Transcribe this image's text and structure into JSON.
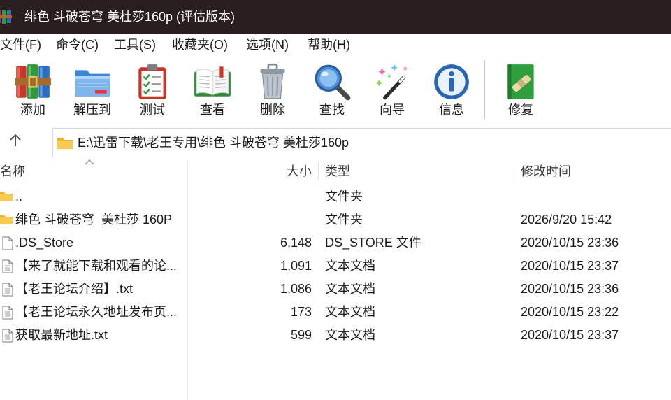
{
  "window": {
    "title": "绯色 斗破苍穹 美杜莎160p (评估版本)",
    "icon": "winrar-app-icon"
  },
  "theme": {
    "titlebar_bg": "#2b1e1e",
    "titlebar_text": "#ffffff",
    "background": "#ffffff"
  },
  "menu": {
    "items": [
      {
        "label": "文件(F)"
      },
      {
        "label": "命令(C)"
      },
      {
        "label": "工具(S)"
      },
      {
        "label": "收藏夹(O)"
      },
      {
        "label": "选项(N)"
      },
      {
        "label": "帮助(H)"
      }
    ]
  },
  "toolbar": {
    "buttons": [
      {
        "label": "添加",
        "icon": "add-archive-icon"
      },
      {
        "label": "解压到",
        "icon": "extract-to-icon"
      },
      {
        "label": "测试",
        "icon": "test-icon"
      },
      {
        "label": "查看",
        "icon": "view-icon"
      },
      {
        "label": "删除",
        "icon": "delete-icon"
      },
      {
        "label": "查找",
        "icon": "find-icon"
      },
      {
        "label": "向导",
        "icon": "wizard-icon"
      },
      {
        "label": "信息",
        "icon": "info-icon"
      },
      {
        "label": "修复",
        "icon": "repair-icon"
      }
    ]
  },
  "address": {
    "up_icon": "up-arrow-icon",
    "folder_icon": "folder-icon",
    "path": "E:\\迅雷下载\\老王专用\\绯色 斗破苍穹 美杜莎160p"
  },
  "columns": {
    "name": "名称",
    "size": "大小",
    "type": "类型",
    "modified": "修改时间",
    "sort_icon": "sort-ascending-icon"
  },
  "files": [
    {
      "icon": "folder-icon",
      "name": "..",
      "type": "文件夹"
    },
    {
      "icon": "folder-icon",
      "name": "绯色 斗破苍穹  美杜莎 160P",
      "type": "文件夹",
      "modified": "2026/9/20 15:42"
    },
    {
      "icon": "file-icon",
      "name": ".DS_Store",
      "size": "6,148",
      "type": "DS_STORE 文件",
      "modified": "2020/10/15 23:36"
    },
    {
      "icon": "text-file-icon",
      "name": "【来了就能下载和观看的论...",
      "size": "1,091",
      "type": "文本文档",
      "modified": "2020/10/15 23:37"
    },
    {
      "icon": "text-file-icon",
      "name": "【老王论坛介绍】.txt",
      "size": "1,086",
      "type": "文本文档",
      "modified": "2020/10/15 23:36"
    },
    {
      "icon": "text-file-icon",
      "name": "【老王论坛永久地址发布页...",
      "size": "173",
      "type": "文本文档",
      "modified": "2020/10/15 23:22"
    },
    {
      "icon": "text-file-icon",
      "name": "获取最新地址.txt",
      "size": "599",
      "type": "文本文档",
      "modified": "2020/10/15 23:37"
    }
  ]
}
